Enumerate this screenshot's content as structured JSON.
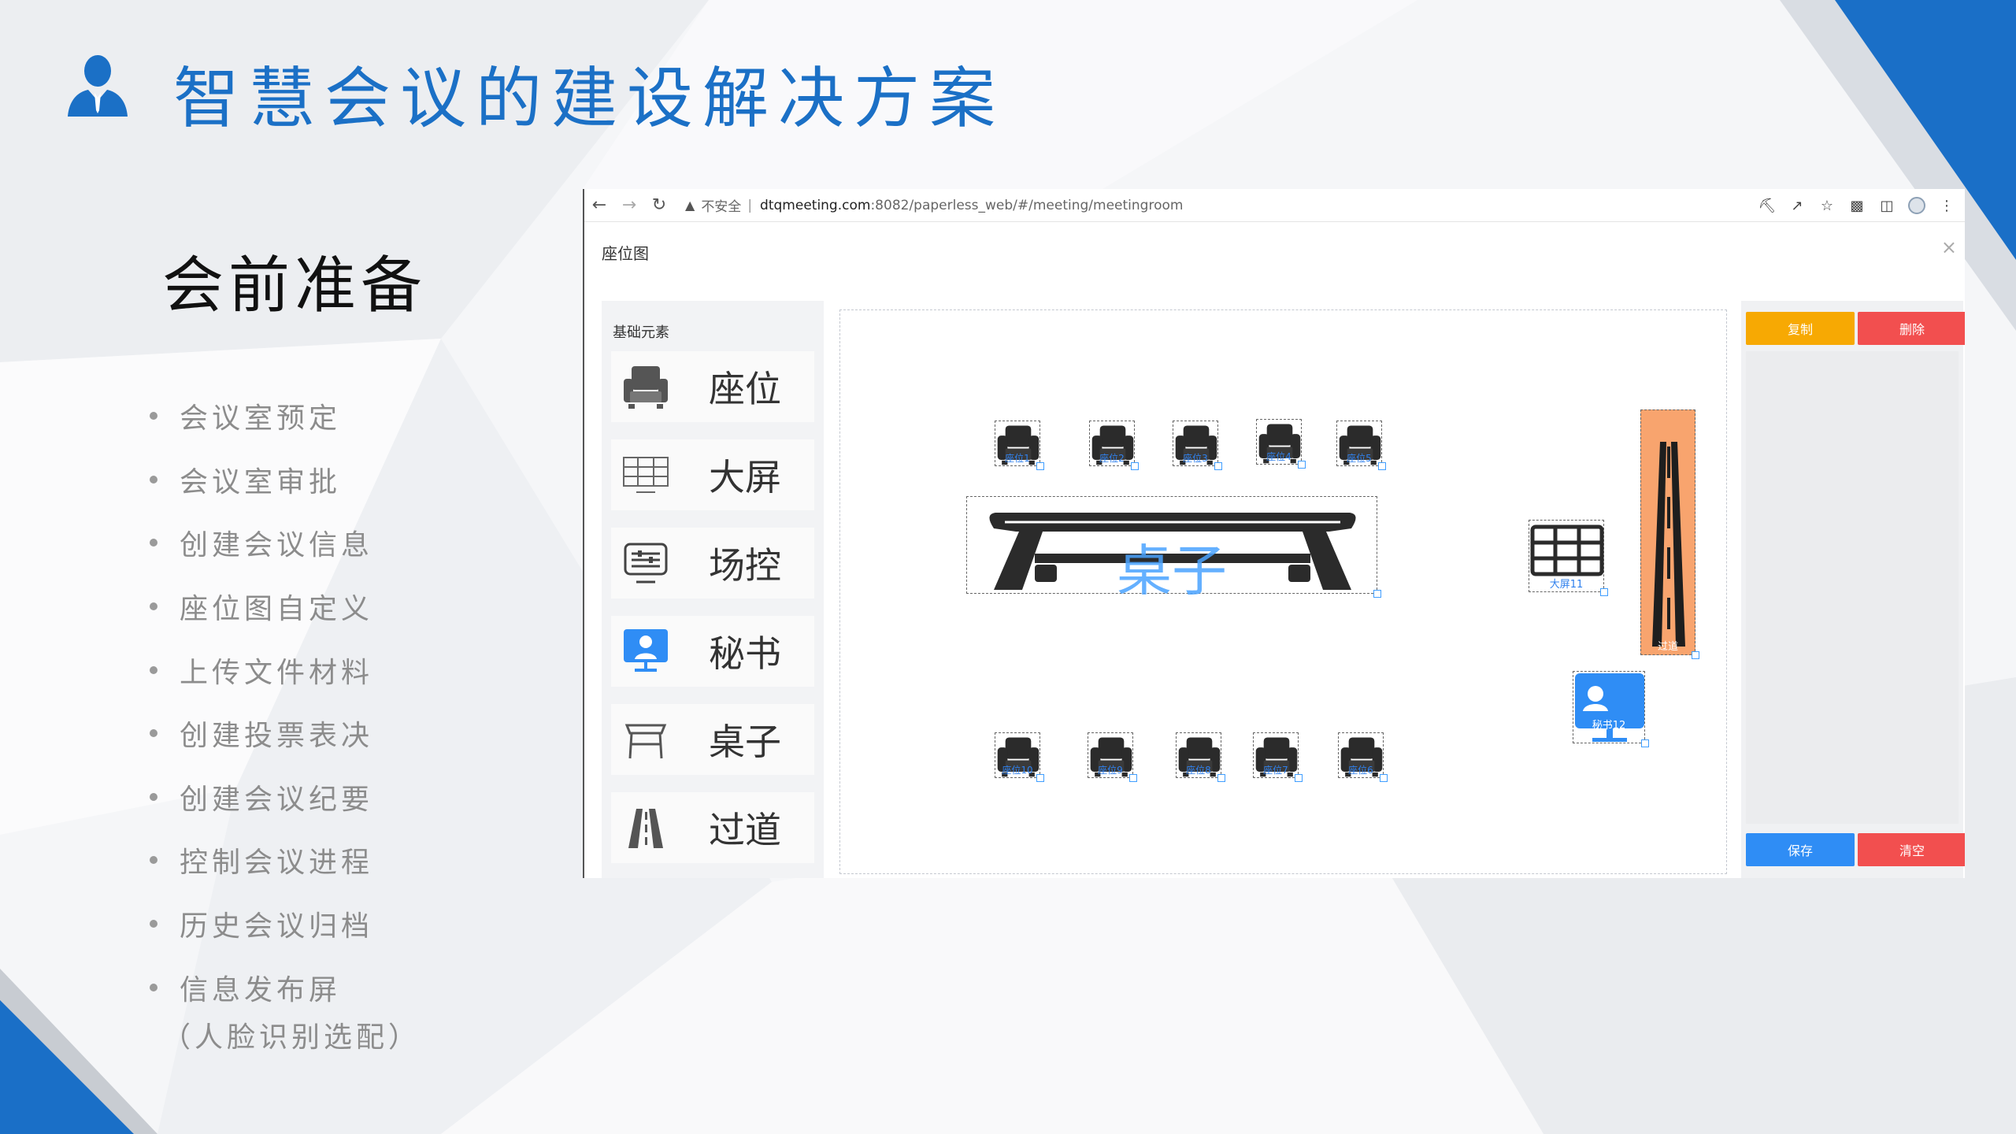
{
  "slide": {
    "title": "智慧会议的建设解决方案",
    "section_title": "会前准备",
    "bullets": [
      "会议室预定",
      "会议室审批",
      "创建会议信息",
      "座位图自定义",
      "上传文件材料",
      "创建投票表决",
      "创建会议纪要",
      "控制会议进程",
      "历史会议归档",
      "信息发布屏"
    ],
    "note": "（人脸识别选配）",
    "accent_color": "#1b70c6"
  },
  "browser": {
    "security_label": "不安全",
    "url_host": "dtqmeeting.com",
    "url_path": ":8082/paperless_web/#/meeting/meetingroom",
    "modal_title": "座位图",
    "close_glyph": "×",
    "icons": [
      "back-icon",
      "forward-icon",
      "reload-icon",
      "warning-icon",
      "key-icon",
      "share-icon",
      "star-icon",
      "extension-icon",
      "sidepanel-icon",
      "profile-icon",
      "menu-icon"
    ]
  },
  "palette": {
    "heading": "基础元素",
    "items": [
      {
        "label": "座位",
        "icon": "seat-icon"
      },
      {
        "label": "大屏",
        "icon": "screen-icon"
      },
      {
        "label": "场控",
        "icon": "control-icon"
      },
      {
        "label": "秘书",
        "icon": "secretary-icon"
      },
      {
        "label": "桌子",
        "icon": "table-icon"
      },
      {
        "label": "过道",
        "icon": "aisle-icon"
      }
    ]
  },
  "canvas": {
    "seats_top": [
      "座位1",
      "座位2",
      "座位3",
      "座位4",
      "座位5"
    ],
    "seats_bottom": [
      "座位10",
      "座位9",
      "座位8",
      "座位7",
      "座位6"
    ],
    "table_label": "桌子",
    "screen_label": "大屏11",
    "aisle_label": "过道",
    "secretary_label": "秘书12"
  },
  "actions": {
    "copy": "复制",
    "delete": "删除",
    "save": "保存",
    "clear": "清空"
  }
}
